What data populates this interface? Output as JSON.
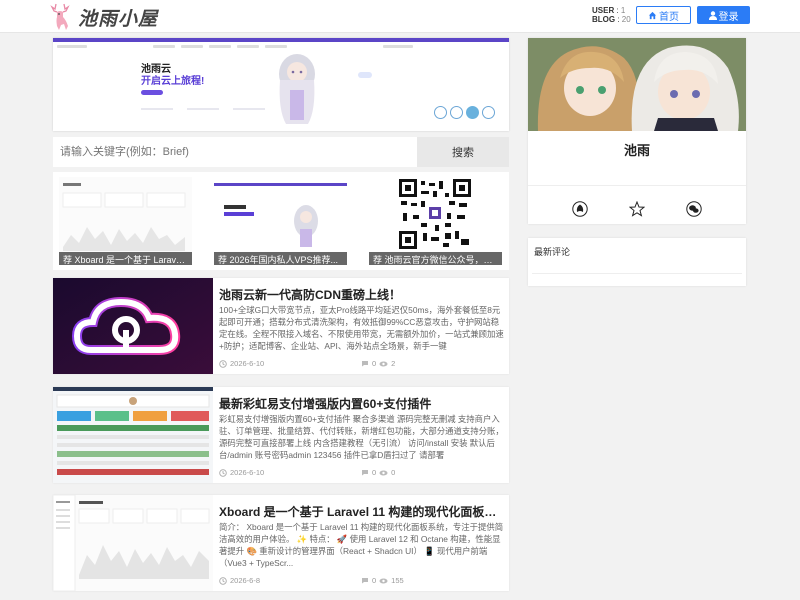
{
  "header": {
    "site_title": "池雨小屋",
    "user_label": "USER",
    "user_count": "1",
    "blog_label": "BLOG",
    "blog_count": "20",
    "home_label": "首页",
    "login_label": "登录"
  },
  "banner": {
    "line1": "池雨云",
    "line2": "开启云上旅程!",
    "active_slide": 3,
    "slide_count": 4
  },
  "search": {
    "placeholder": "请输入关键字(例如：Brief)",
    "button_label": "搜索"
  },
  "recommended": [
    {
      "caption": "荐 Xboard 是一个基于 Laravel..."
    },
    {
      "caption": "荐 2026年国内私人VPS推荐..."
    },
    {
      "caption": "荐 池雨云官方微信公众号，全..."
    }
  ],
  "posts": [
    {
      "title": "池雨云新一代高防CDN重磅上线！",
      "excerpt": "100+全球G口大带宽节点，亚太Pro线路平均延迟仅50ms，海外套餐低至8元起即可开通；搭载分布式清洗架构，有效抵御99%CC恶意攻击，守护网站稳定在线。全程不限接入域名、不限使用带宽，无需额外加价，一站式兼顾加速+防护；适配博客、企业站、API、海外站点全场景，新手一键",
      "date": "2026-6-10",
      "comments": "0",
      "views": "2"
    },
    {
      "title": "最新彩虹易支付增强版内置60+支付插件",
      "excerpt": "彩虹易支付增强版内置60+支付插件 聚合多渠道 源码完整无删减 支持商户入驻、订单管理、批量结算、代付转账，新增红包功能，大部分通道支持分账，源码完整可直接部署上线 内含搭建教程（无引流） 访问/install 安装 默认后台/admin 账号密码admin 123456 插件已拿D盾扫过了 请部署",
      "date": "2026-6-10",
      "comments": "0",
      "views": "0"
    },
    {
      "title": "Xboard 是一个基于 Laravel 11 构建的现代化面板系统",
      "excerpt": "简介： Xboard 是一个基于 Laravel 11 构建的现代化面板系统，专注于提供简洁高效的用户体验。 ✨ 特点： 🚀 使用 Laravel 12 和 Octane 构建，性能显著提升 🎨 重新设计的管理界面（React + Shadcn UI） 📱 现代用户前端（Vue3 + TypeScr...",
      "date": "2026-6-8",
      "comments": "0",
      "views": "155"
    }
  ],
  "sidebar": {
    "author_name": "池雨",
    "comments_title": "最新评论"
  },
  "colors": {
    "accent": "#2b7cf6",
    "banner_purple": "#5b45c7"
  }
}
